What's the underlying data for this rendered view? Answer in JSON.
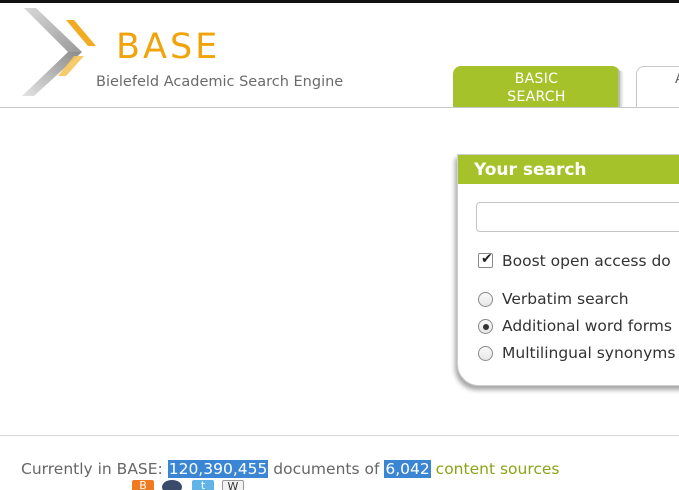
{
  "logo": {
    "wordmark": "BASE",
    "subtitle": "Bielefeld Academic Search Engine",
    "colors": {
      "wordmark": "#f0a30a",
      "chevron": "#aaaaaa"
    }
  },
  "tabs": {
    "basic_line1": "BASIC",
    "basic_line2": "SEARCH",
    "advanced_fragment": "A"
  },
  "search_panel": {
    "title": "Your search",
    "query_value": "",
    "boost_label": "Boost open access do",
    "boost_checked": true,
    "modes": [
      {
        "label": "Verbatim search",
        "selected": false
      },
      {
        "label": "Additional word forms",
        "selected": true
      },
      {
        "label": "Multilingual synonyms",
        "selected": false
      }
    ]
  },
  "stats": {
    "prefix": "Currently in BASE:",
    "documents_count": "120,390,455",
    "documents_text": "documents of",
    "sources_count": "6,042",
    "sources_link": "content sources"
  },
  "social_icons": [
    "blogger-icon",
    "feed-icon",
    "twitter-icon",
    "wikipedia-icon"
  ],
  "colors": {
    "accent": "#a6c22a",
    "highlight": "#3b86d4",
    "link": "#8aa417"
  }
}
